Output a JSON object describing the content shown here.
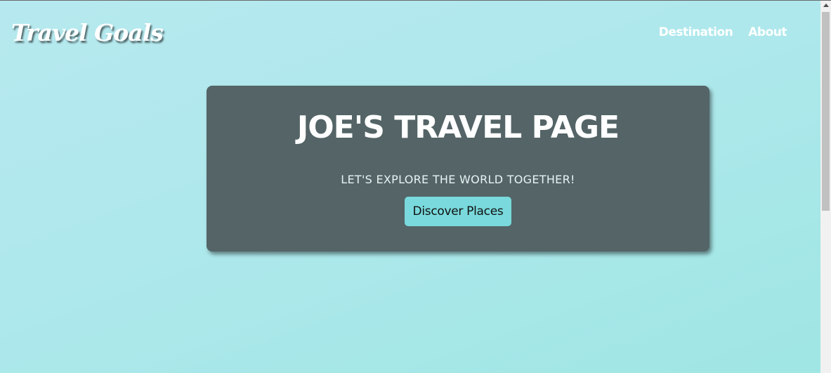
{
  "header": {
    "logo_text": "Travel Goals",
    "nav": [
      {
        "label": "Destination"
      },
      {
        "label": "About"
      }
    ]
  },
  "hero": {
    "title": "JOE'S TRAVEL PAGE",
    "subtitle": "LET'S EXPLORE THE WORLD TOGETHER!",
    "button_label": "Discover Places"
  },
  "colors": {
    "background": "#aee8ec",
    "hero_panel": "#546467",
    "button": "#79d9dc"
  },
  "scrollbar": {
    "position_fraction": 0.0
  }
}
